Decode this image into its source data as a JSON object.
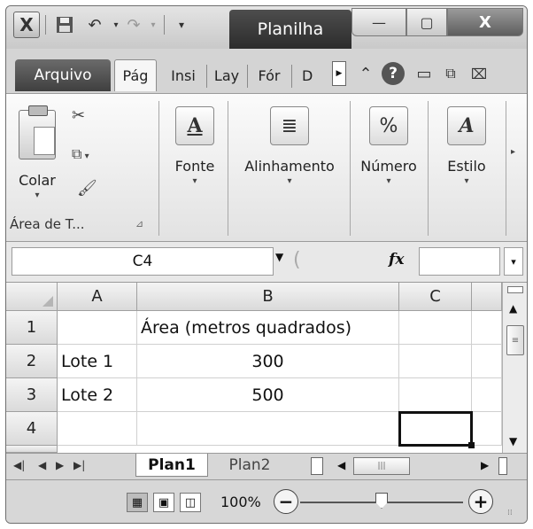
{
  "app": {
    "title": "Planilha",
    "icon": "excel-app-icon",
    "quick_access": [
      "save-icon",
      "undo-icon",
      "redo-icon",
      "customize-qat-icon"
    ]
  },
  "window_controls": {
    "minimize": "—",
    "maximize": "▢",
    "close": "X"
  },
  "ribbon_tabs": [
    {
      "label": "Arquivo",
      "kind": "file"
    },
    {
      "label": "Pág",
      "active": true
    },
    {
      "label": "Insi"
    },
    {
      "label": "Lay"
    },
    {
      "label": "Fór"
    },
    {
      "label": "D"
    }
  ],
  "ribbon_groups": {
    "clipboard": {
      "paste_label": "Colar",
      "caption": "Área de T..."
    },
    "font": {
      "label": "Fonte"
    },
    "alignment": {
      "label": "Alinhamento"
    },
    "number": {
      "label": "Número",
      "icon_text": "%"
    },
    "style": {
      "label": "Estilo"
    }
  },
  "formula_bar": {
    "name_box": "C4",
    "fx_label": "fx",
    "formula": ""
  },
  "grid": {
    "columns": [
      "A",
      "B",
      "C"
    ],
    "rows": [
      {
        "num": "1",
        "A": "",
        "B": "Área (metros quadrados)",
        "C": ""
      },
      {
        "num": "2",
        "A": "Lote 1",
        "B": "300",
        "C": ""
      },
      {
        "num": "3",
        "A": "Lote 2",
        "B": "500",
        "C": ""
      },
      {
        "num": "4",
        "A": "",
        "B": "",
        "C": ""
      }
    ],
    "selected_cell": "C4"
  },
  "sheets": [
    {
      "label": "Plan1",
      "active": true
    },
    {
      "label": "Plan2",
      "active": false
    }
  ],
  "status": {
    "zoom": "100%",
    "zoom_level": 1.0
  }
}
